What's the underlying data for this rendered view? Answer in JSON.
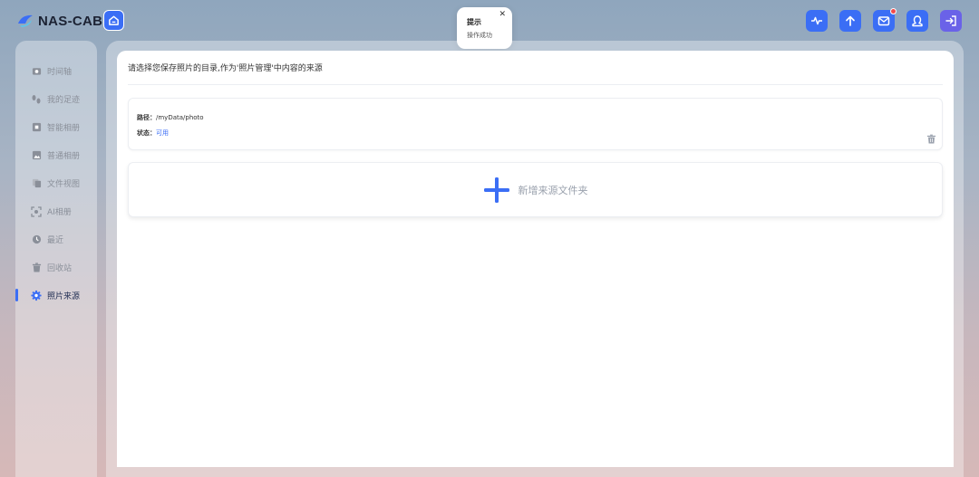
{
  "app": {
    "name": "NAS-CAB"
  },
  "toast": {
    "title": "提示",
    "message": "操作成功",
    "close_glyph": "✕"
  },
  "topbar": {
    "icons": [
      {
        "name": "activity-icon"
      },
      {
        "name": "upload-icon"
      },
      {
        "name": "mail-icon",
        "badge": true
      },
      {
        "name": "user-icon"
      },
      {
        "name": "logout-icon"
      }
    ]
  },
  "sidebar": {
    "items": [
      {
        "label": "时间轴",
        "icon": "camera-icon",
        "active": false
      },
      {
        "label": "我的足迹",
        "icon": "footprints-icon",
        "active": false
      },
      {
        "label": "智能相册",
        "icon": "smart-album-icon",
        "active": false
      },
      {
        "label": "普通相册",
        "icon": "image-icon",
        "active": false
      },
      {
        "label": "文件视图",
        "icon": "files-icon",
        "active": false
      },
      {
        "label": "AI相册",
        "icon": "ai-scan-icon",
        "active": false
      },
      {
        "label": "最近",
        "icon": "clock-icon",
        "active": false
      },
      {
        "label": "回收站",
        "icon": "trash-icon",
        "active": false
      },
      {
        "label": "照片来源",
        "icon": "gear-icon",
        "active": true
      }
    ]
  },
  "main": {
    "description": "请选择您保存照片的目录,作为'照片管理'中内容的来源",
    "source": {
      "path_key": "路径：",
      "path_value": "/myData/photo",
      "status_key": "状态：",
      "status_value": "可用"
    },
    "add_label": "新增来源文件夹"
  },
  "colors": {
    "accent": "#3b6ef5",
    "exit": "#6a62e8",
    "badge": "#f24a4a"
  }
}
